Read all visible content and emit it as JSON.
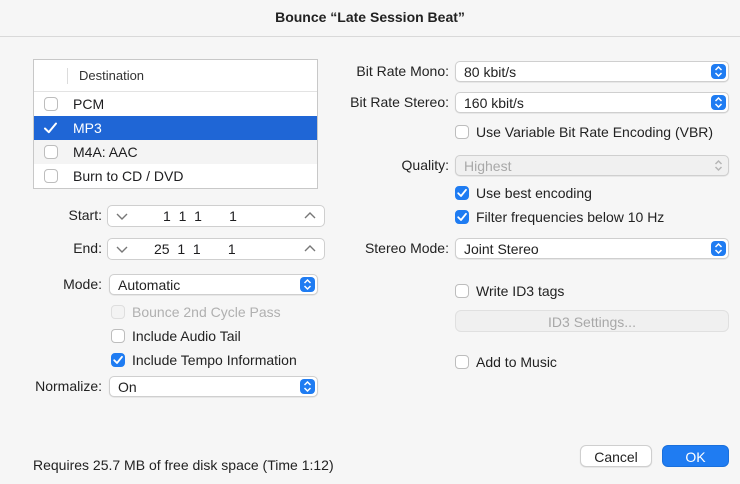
{
  "window": {
    "title": "Bounce “Late Session Beat”"
  },
  "destination": {
    "header": "Destination",
    "items": [
      {
        "label": "PCM",
        "checked": false,
        "selected": false
      },
      {
        "label": "MP3",
        "checked": true,
        "selected": true
      },
      {
        "label": "M4A: AAC",
        "checked": false,
        "selected": false
      },
      {
        "label": "Burn to CD / DVD",
        "checked": false,
        "selected": false
      }
    ]
  },
  "range": {
    "start_label": "Start:",
    "start_value": "1  1  1       1",
    "end_label": "End:",
    "end_value": "25  1  1       1"
  },
  "mode": {
    "label": "Mode:",
    "value": "Automatic"
  },
  "options": {
    "bounce_2nd_cycle": "Bounce 2nd Cycle Pass",
    "include_audio_tail": "Include Audio Tail",
    "include_tempo": "Include Tempo Information"
  },
  "normalize": {
    "label": "Normalize:",
    "value": "On"
  },
  "mp3": {
    "bitrate_mono_label": "Bit Rate Mono:",
    "bitrate_mono_value": "80 kbit/s",
    "bitrate_stereo_label": "Bit Rate Stereo:",
    "bitrate_stereo_value": "160 kbit/s",
    "vbr_label": "Use Variable Bit Rate Encoding (VBR)",
    "quality_label": "Quality:",
    "quality_value": "Highest",
    "best_encoding_label": "Use best encoding",
    "filter_label": "Filter frequencies below 10 Hz",
    "stereo_mode_label": "Stereo Mode:",
    "stereo_mode_value": "Joint Stereo",
    "id3_label": "Write ID3 tags",
    "id3_settings_button": "ID3 Settings...",
    "add_to_music_label": "Add to Music"
  },
  "footer": {
    "disk_info": "Requires 25.7 MB of free disk space  (Time 1:12)",
    "cancel_button": "Cancel",
    "ok_button": "OK"
  },
  "colors": {
    "accent": "#1f7cf2",
    "selection": "#1f66d6"
  }
}
